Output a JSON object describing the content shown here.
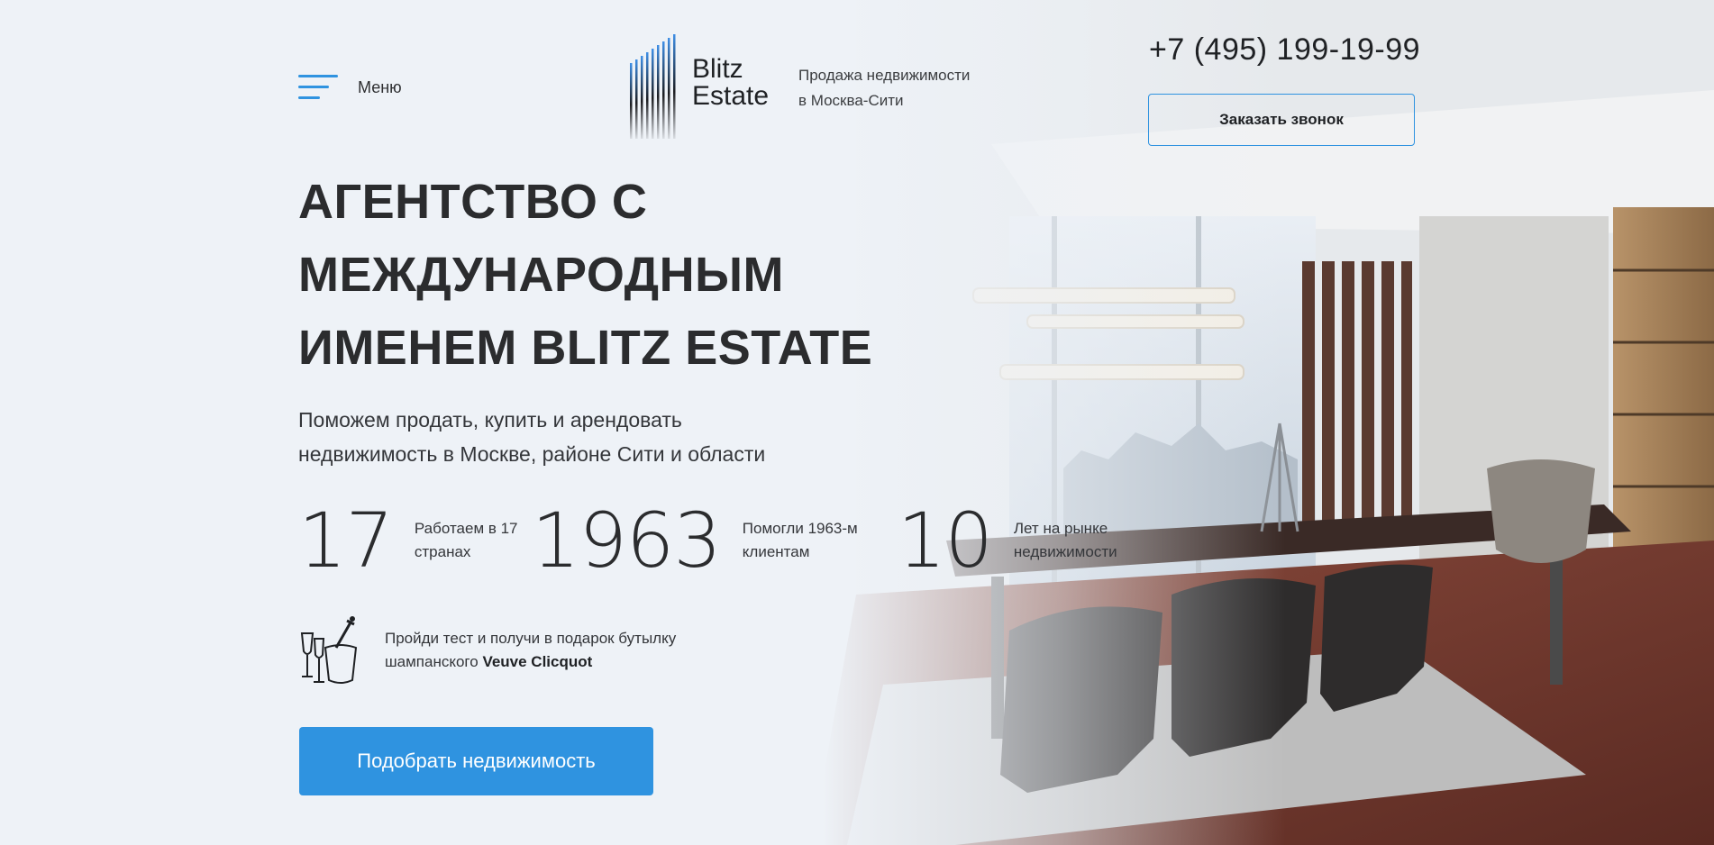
{
  "header": {
    "menu_label": "Меню",
    "logo": {
      "line1": "Blitz",
      "line2": "Estate"
    },
    "tagline": [
      "Продажа недвижимости",
      "в Москва-Сити"
    ],
    "phone": "+7 (495) 199-19-99",
    "callback_label": "Заказать звонок"
  },
  "hero": {
    "title_lines": [
      "АГЕНТСТВО С",
      "МЕЖДУНАРОДНЫМ",
      "ИМЕНЕМ BLITZ ESTATE"
    ],
    "subtitle_lines": [
      "Поможем продать, купить и арендовать",
      "недвижимость в Москве, районе Сити и области"
    ],
    "stats": [
      {
        "value": "17",
        "label": "Работаем в 17 странах"
      },
      {
        "value": "1963",
        "label": "Помогли 1963-м клиентам"
      },
      {
        "value": "10",
        "label": "Лет на рынке недвижимости"
      }
    ],
    "promo": {
      "text": "Пройди тест и получи в подарок бутылку шампанского",
      "brand": "Veuve Clicquot",
      "icon": "champagne-bucket-icon"
    },
    "cta_label": "Подобрать недвижимость"
  },
  "colors": {
    "accent": "#2f93e0",
    "background": "#eef2f7",
    "text": "#2b2c2e"
  }
}
